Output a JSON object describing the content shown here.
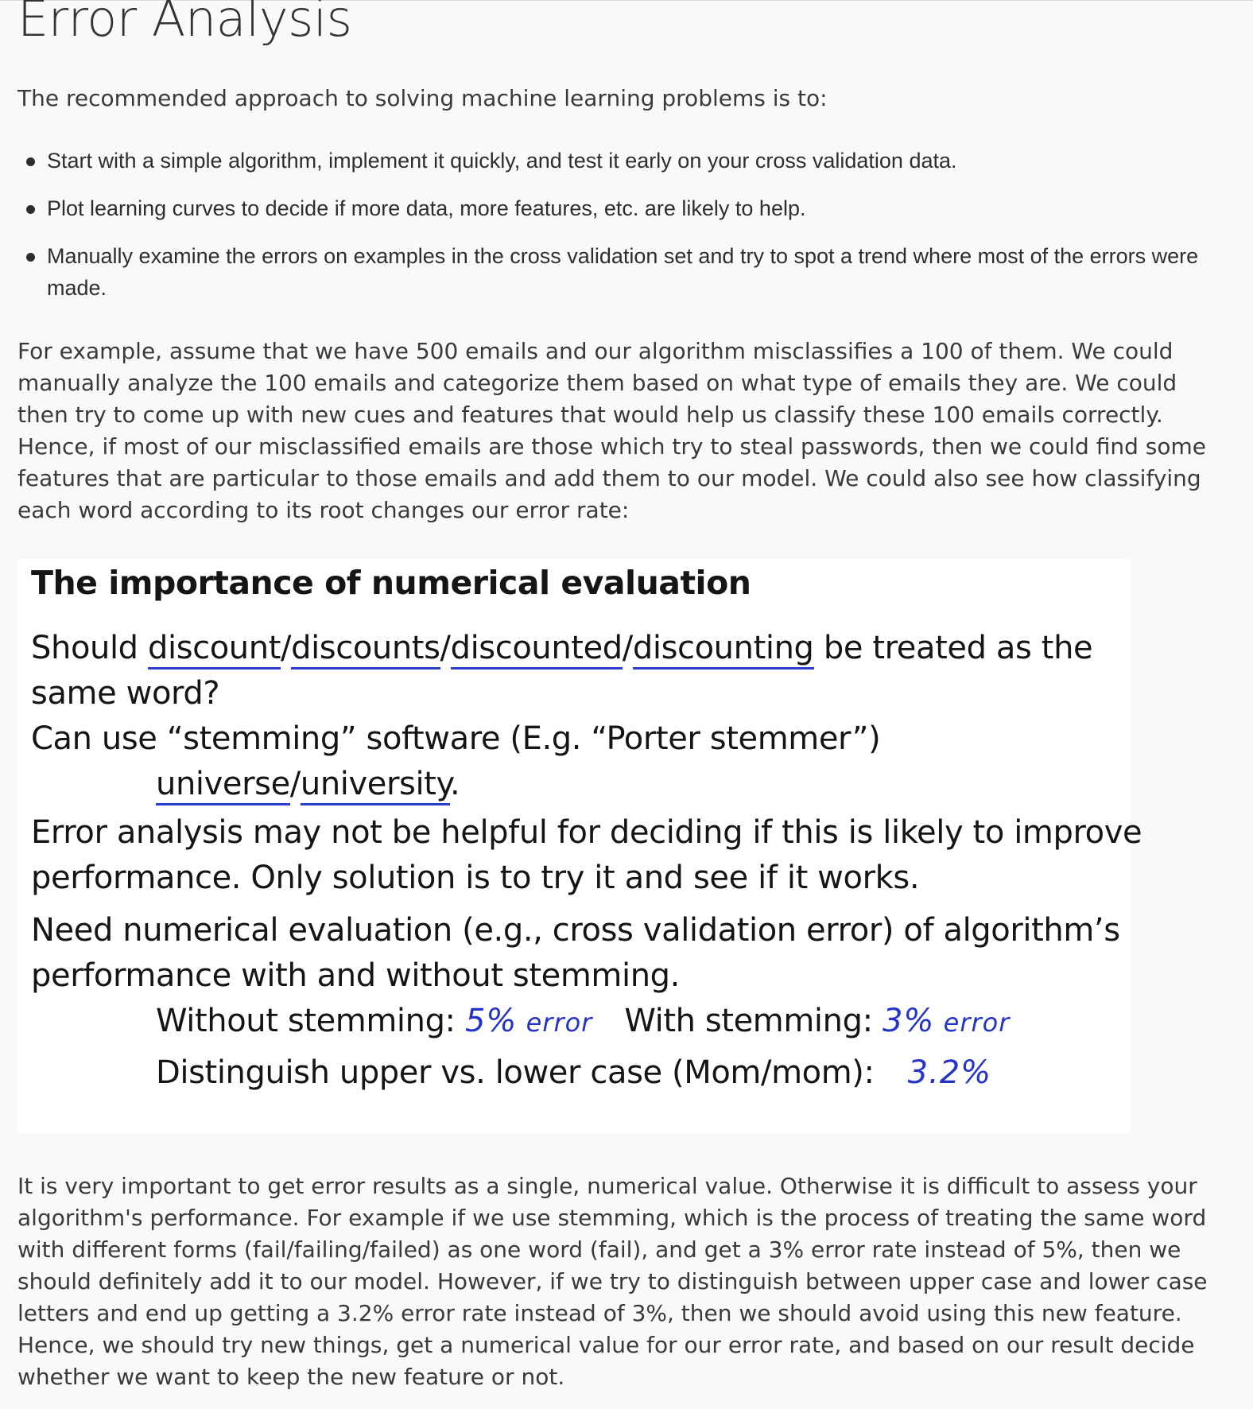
{
  "page_title": "Error Analysis",
  "intro": "The recommended approach to solving machine learning problems is to:",
  "steps": [
    "Start with a simple algorithm, implement it quickly, and test it early on your cross validation data.",
    "Plot learning curves to decide if more data, more features, etc. are likely to help.",
    "Manually examine the errors on examples in the cross validation set and try to spot a trend where most of the errors were made."
  ],
  "para1": "For example, assume that we have 500 emails and our algorithm misclassifies a 100 of them. We could manually analyze the 100 emails and categorize them based on what type of emails they are. We could then try to come up with new cues and features that would help us classify these 100 emails correctly. Hence, if most of our misclassified emails are those which try to steal passwords, then we could find some features that are particular to those emails and add them to our model. We could also see how classifying each word according to its root changes our error rate:",
  "slide": {
    "title": "The importance of numerical evaluation",
    "q_word1": "discount",
    "q_sep1": "/",
    "q_word2": "discounts",
    "q_sep2": "/",
    "q_word3": "discounted",
    "q_sep3": "/",
    "q_word4": "discounting",
    "q_prefix": "Should ",
    "q_suffix": " be treated as the",
    "q_line2": "same word?",
    "stem_line": "Can use “stemming” software (E.g. “Porter stemmer”)",
    "universe": "universe",
    "uni_sep": "/",
    "university": "university",
    "uni_end": ".",
    "ea_line1": "Error analysis may not be helpful for deciding if this is likely to improve",
    "ea_line2": "performance. Only solution is to try it and see if it works.",
    "need_line1": "Need numerical evaluation (e.g., cross validation error) of algorithm’s",
    "need_line2": "performance with and without stemming.",
    "without_label": "Without stemming: ",
    "without_value": "5%",
    "without_note": " error",
    "with_label": "With stemming: ",
    "with_value": "3%",
    "with_note": " error",
    "case_label": "Distinguish upper vs. lower case (Mom/mom):",
    "case_value": "3.2%"
  },
  "para2": "It is very important to get error results as a single, numerical value. Otherwise it is difficult to assess your algorithm's performance. For example if we use stemming, which is the process of treating the same word with different forms (fail/failing/failed) as one word (fail), and get a 3% error rate instead of 5%, then we should definitely add it to our model. However, if we try to distinguish between upper case and lower case letters and end up getting a 3.2% error rate instead of 3%, then we should avoid using this new feature. Hence, we should try new things, get a numerical value for our error rate, and based on our result decide whether we want to keep the new feature or not.",
  "colors": {
    "background": "#f9f9f9",
    "text": "#3a3a3a",
    "handwriting": "#2434c8"
  }
}
